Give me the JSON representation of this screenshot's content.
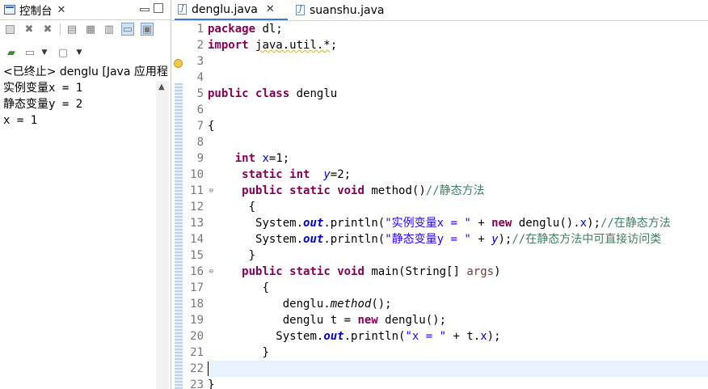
{
  "console": {
    "tab_label": "控制台",
    "close_glyph": "✕",
    "process_label": "<已终止> denglu [Java 应用程",
    "output_lines": [
      "实例变量x = 1",
      "静态变量y = 2",
      "x = 1"
    ],
    "toolbar_row1_icons": [
      "terminate-icon",
      "remove-launch-icon",
      "remove-all-icon",
      "clear-console-icon",
      "scroll-lock-icon",
      "word-wrap-icon",
      "show-on-stdout-icon",
      "show-on-stderr-icon"
    ],
    "toolbar_row2_icons": [
      "pin-console-icon",
      "display-selected-console-icon",
      "open-console-icon"
    ]
  },
  "editor": {
    "tabs": [
      {
        "label": "denglu.java",
        "active": true,
        "close_glyph": "✕"
      },
      {
        "label": "suanshu.java",
        "active": false
      }
    ],
    "line_numbers": [
      "1",
      "2",
      "3",
      "4",
      "5",
      "6",
      "7",
      "8",
      "9",
      "10",
      "11",
      "12",
      "13",
      "14",
      "15",
      "16",
      "17",
      "18",
      "19",
      "20",
      "21",
      "22",
      "23"
    ],
    "code": {
      "l1_kw": "package",
      "l1_rest": " dl;",
      "l2_kw": "import",
      "l2_pkg": "java.util.*",
      "l2_rest": ";",
      "l5_kw1": "public",
      "l5_kw2": "class",
      "l5_rest": " denglu",
      "l7": "{",
      "l9_kw": "int",
      "l9_fld": "x",
      "l9_rest": "=1;",
      "l10_kw1": "static",
      "l10_kw2": "int",
      "l10_fld": "y",
      "l10_rest": "=2;",
      "l11_kw1": "public",
      "l11_kw2": "static",
      "l11_kw3": "void",
      "l11_rest": " method()",
      "l11_cm": "//静态方法",
      "l12": "{",
      "l13_a": "System.",
      "l13_out": "out",
      "l13_b": ".println(",
      "l13_str": "\"实例变量x = \"",
      "l13_c": " + ",
      "l13_kw": "new",
      "l13_d": " denglu().",
      "l13_fld": "x",
      "l13_e": ");",
      "l13_cm": "//在静态方法",
      "l14_a": "System.",
      "l14_out": "out",
      "l14_b": ".println(",
      "l14_str": "\"静态变量y = \"",
      "l14_c": " + ",
      "l14_fld": "y",
      "l14_e": ");",
      "l14_cm": "//在静态方法中可直接访问类",
      "l15": "}",
      "l16_kw1": "public",
      "l16_kw2": "static",
      "l16_kw3": "void",
      "l16_a": " main(String[] ",
      "l16_param": "args",
      "l16_b": ")",
      "l17": "{",
      "l18_a": "denglu.",
      "l18_m": "method",
      "l18_b": "();",
      "l19_a": "denglu t = ",
      "l19_kw": "new",
      "l19_b": " denglu();",
      "l20_a": "System.",
      "l20_out": "out",
      "l20_b": ".println(",
      "l20_str": "\"x = \"",
      "l20_c": " + t.",
      "l20_fld": "x",
      "l20_d": ");",
      "l21": "}",
      "l23": "}"
    }
  },
  "colors": {
    "keyword": "#7f0055",
    "string": "#2a00ff",
    "comment": "#3f7f5f",
    "field": "#0000c0",
    "current_line": "#e8f2fe",
    "active_tab_underline": "#3b79d6"
  }
}
